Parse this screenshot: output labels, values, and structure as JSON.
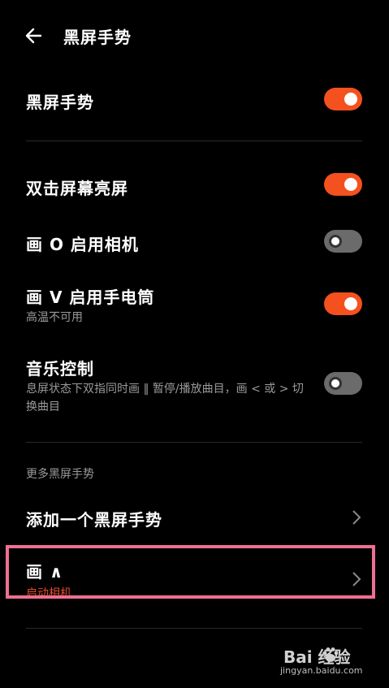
{
  "header": {
    "title": "黑屏手势",
    "back_icon": "back-arrow-icon"
  },
  "items": [
    {
      "label": "黑屏手势",
      "sub": "",
      "toggle": true
    },
    {
      "label": "双击屏幕亮屏",
      "sub": "",
      "toggle": true
    },
    {
      "label": "画 O 启用相机",
      "sub": "",
      "toggle": false
    },
    {
      "label": "画 V 启用手电筒",
      "sub": "高温不可用",
      "toggle": true
    },
    {
      "label": "音乐控制",
      "sub": "息屏状态下双指同时画 ‖ 暂停/播放曲目，画 < 或 > 切换曲目",
      "toggle": false
    }
  ],
  "more_section": {
    "title": "更多黑屏手势",
    "add_label": "添加一个黑屏手势",
    "draw_label": "画 ∧",
    "draw_sub": "启动相机"
  },
  "colors": {
    "accent": "#f4511e",
    "highlight_box": "#ef6f93",
    "toggle_off": "#6b6b6b"
  },
  "watermark": {
    "logo_text": "Bai  经验",
    "site": "jingyan.baidu.com"
  }
}
